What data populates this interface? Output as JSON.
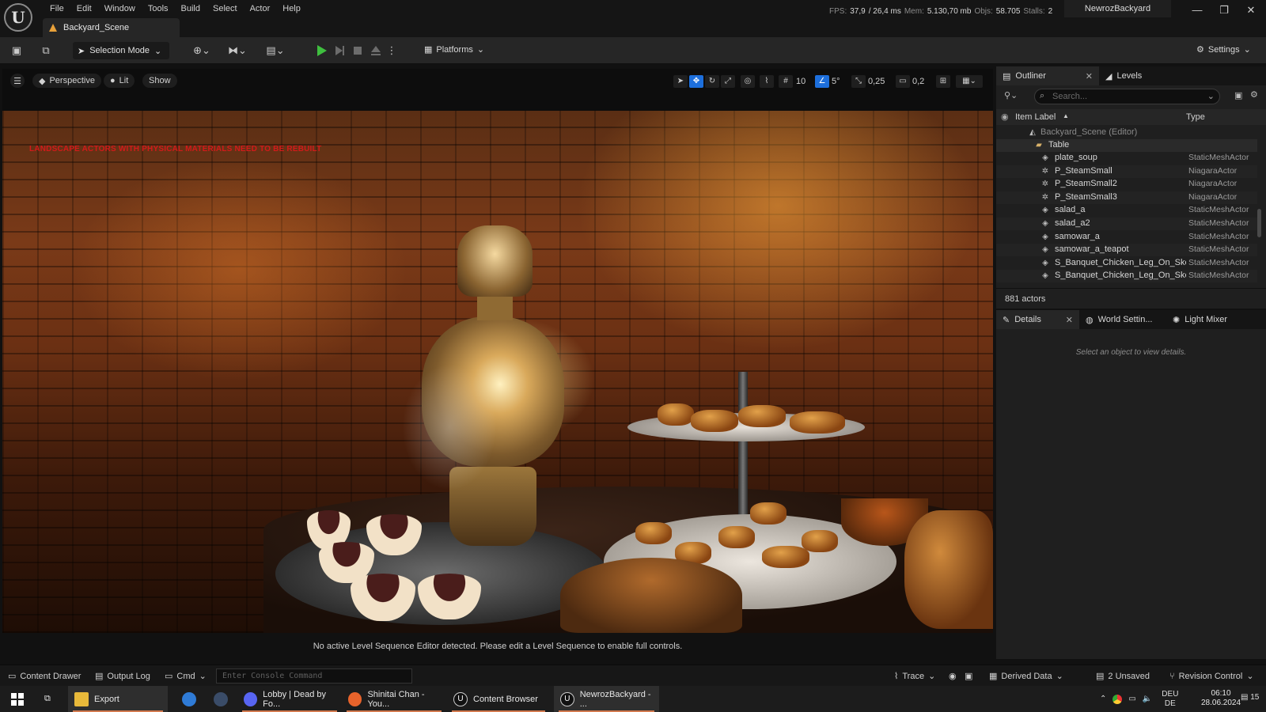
{
  "menu": [
    "File",
    "Edit",
    "Window",
    "Tools",
    "Build",
    "Select",
    "Actor",
    "Help"
  ],
  "document_tab": "Backyard_Scene",
  "stats": {
    "fps_label": "FPS:",
    "fps": "37,9",
    "ms": "/ 26,4 ms",
    "mem_label": "Mem:",
    "mem": "5.130,70 mb",
    "objs_label": "Objs:",
    "objs": "58.705",
    "stalls_label": "Stalls:",
    "stalls": "2"
  },
  "project_name": "NewrozBackyard",
  "window_controls": {
    "minimize": "—",
    "restore": "❐",
    "close": "✕"
  },
  "toolbar": {
    "selection_mode": "Selection Mode",
    "platforms": "Platforms",
    "settings": "Settings"
  },
  "viewport": {
    "perspective": "Perspective",
    "lit": "Lit",
    "show": "Show",
    "grid_snap": "10",
    "rotation_snap": "5°",
    "scale_snap": "0,25",
    "camera_speed": "0,2",
    "warning": "LANDSCAPE ACTORS WITH PHYSICAL MATERIALS NEED TO BE REBUILT",
    "sequence_message": "No active Level Sequence Editor detected. Please edit a Level Sequence to enable full controls."
  },
  "outliner": {
    "tab_outliner": "Outliner",
    "tab_levels": "Levels",
    "search_placeholder": "Search...",
    "col_label": "Item Label",
    "col_type": "Type",
    "root": "Backyard_Scene (Editor)",
    "folder": "Table",
    "items": [
      {
        "label": "plate_soup",
        "type": "StaticMeshActor",
        "icon": "mesh-icon"
      },
      {
        "label": "P_SteamSmall",
        "type": "NiagaraActor",
        "icon": "niagara-icon"
      },
      {
        "label": "P_SteamSmall2",
        "type": "NiagaraActor",
        "icon": "niagara-icon"
      },
      {
        "label": "P_SteamSmall3",
        "type": "NiagaraActor",
        "icon": "niagara-icon"
      },
      {
        "label": "salad_a",
        "type": "StaticMeshActor",
        "icon": "mesh-icon"
      },
      {
        "label": "salad_a2",
        "type": "StaticMeshActor",
        "icon": "mesh-icon"
      },
      {
        "label": "samowar_a",
        "type": "StaticMeshActor",
        "icon": "mesh-icon"
      },
      {
        "label": "samowar_a_teapot",
        "type": "StaticMeshActor",
        "icon": "mesh-icon"
      },
      {
        "label": "S_Banquet_Chicken_Leg_On_Skew",
        "type": "StaticMeshActor",
        "icon": "mesh-icon"
      },
      {
        "label": "S_Banquet_Chicken_Leg_On_Skew",
        "type": "StaticMeshActor",
        "icon": "mesh-icon"
      }
    ],
    "actor_count": "881 actors"
  },
  "details": {
    "tab_details": "Details",
    "tab_world": "World Settin...",
    "tab_light": "Light Mixer",
    "empty_message": "Select an object to view details."
  },
  "statusbar": {
    "content_drawer": "Content Drawer",
    "output_log": "Output Log",
    "cmd": "Cmd",
    "console_placeholder": "Enter Console Command",
    "trace": "Trace",
    "derived_data": "Derived Data",
    "unsaved": "2 Unsaved",
    "revision_control": "Revision Control"
  },
  "taskbar": {
    "explorer": "Export",
    "discord": "Lobby | Dead by Fo...",
    "firefox": "Shinitai Chan - You...",
    "content_browser": "Content Browser",
    "unreal": "NewrozBackyard - ...",
    "lang_top": "DEU",
    "lang_bottom": "DE",
    "time": "06:10",
    "date": "28.06.2024",
    "notifications": "15"
  },
  "colors": {
    "accent_blue": "#1d6fdc",
    "play_green": "#3fbf3f",
    "warning_red": "#d21a1a",
    "doc_tab_icon": "#e8a13a"
  }
}
